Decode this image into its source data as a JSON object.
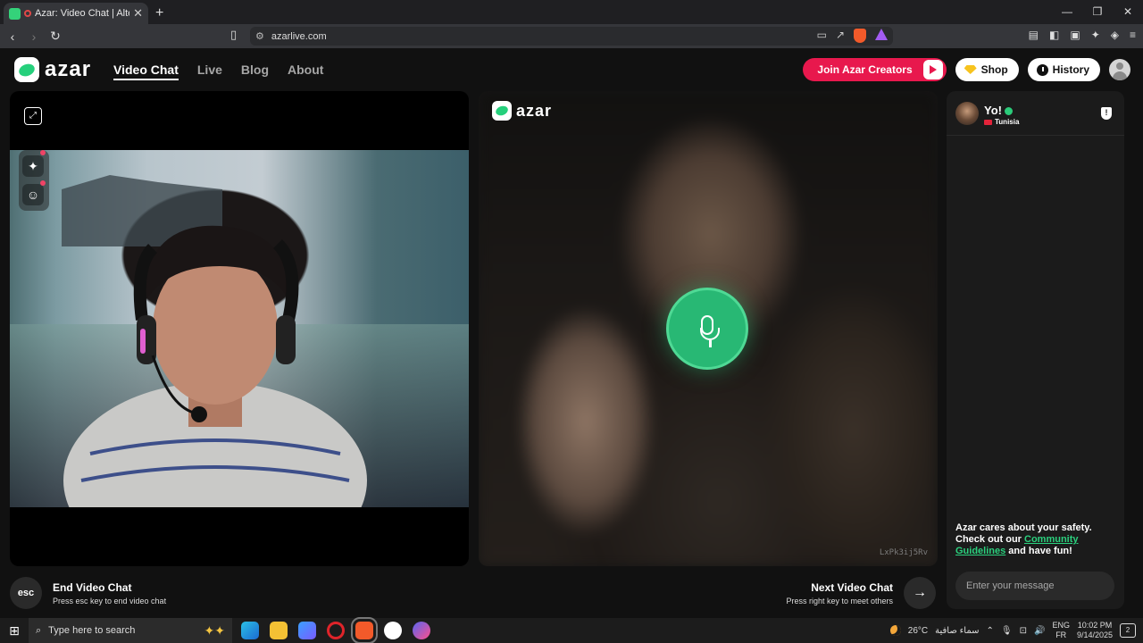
{
  "browser": {
    "tab_title": "Azar: Video Chat | Alternative",
    "tab_close": "✕",
    "new_tab": "+",
    "url": "azarlive.com",
    "win_min": "—",
    "win_max": "❐",
    "win_close": "✕"
  },
  "site": {
    "logo_text": "azar",
    "nav": [
      {
        "label": "Video Chat"
      },
      {
        "label": "Live"
      },
      {
        "label": "Blog"
      },
      {
        "label": "About"
      }
    ],
    "join_label": "Join Azar Creators",
    "shop_label": "Shop",
    "history_label": "History"
  },
  "video": {
    "remote_logo_text": "azar",
    "remote_id": "LxPk3ij5Rv"
  },
  "chat": {
    "name": "Yo!",
    "country": "Tunisia",
    "safety_prefix": "Azar cares about your safety. Check out our ",
    "safety_link": "Community Guidelines",
    "safety_suffix": " and have fun!",
    "input_placeholder": "Enter your message"
  },
  "controls": {
    "esc_label": "esc",
    "end_title": "End Video Chat",
    "end_sub": "Press esc key to end video chat",
    "next_title": "Next Video Chat",
    "next_sub": "Press right key to meet others",
    "next_arrow": "→"
  },
  "taskbar": {
    "search_placeholder": "Type here to search",
    "temperature": "26°C",
    "weather": "سماء صافية",
    "lang1": "ENG",
    "lang2": "FR",
    "time": "10:02 PM",
    "date": "9/14/2025",
    "notif_count": "2"
  },
  "colors": {
    "brand_green": "#26d07c",
    "join_red": "#e8184d",
    "mic_green": "#28b874"
  }
}
